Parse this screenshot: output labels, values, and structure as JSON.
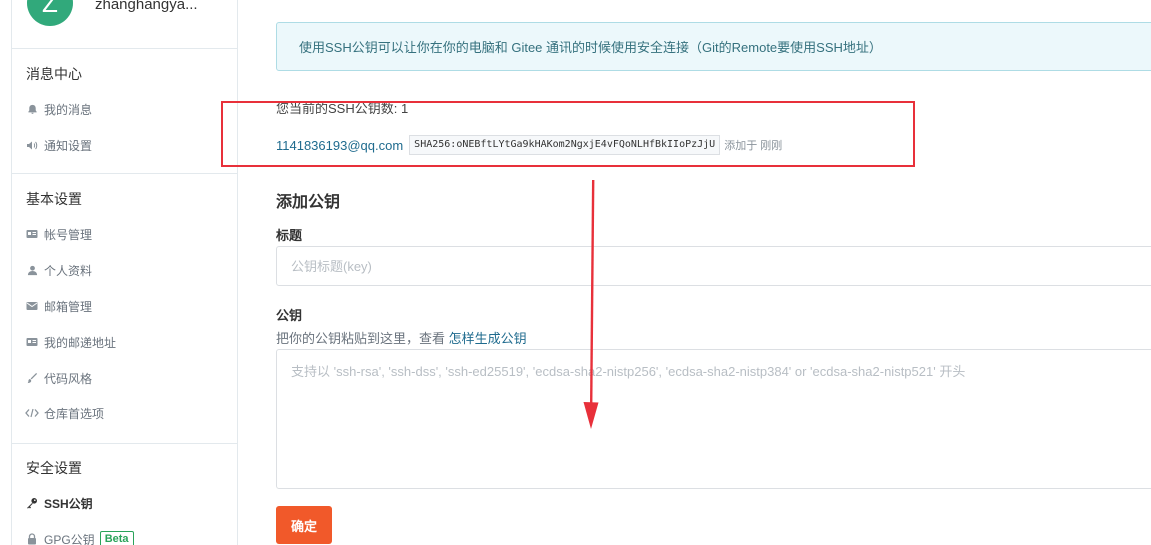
{
  "profile": {
    "avatar_letter": "Z",
    "username": "zhanghangya..."
  },
  "sidebar": {
    "messages": {
      "title": "消息中心",
      "items": [
        {
          "label": "我的消息",
          "icon": "bell-icon"
        },
        {
          "label": "通知设置",
          "icon": "volume-icon"
        }
      ]
    },
    "basic": {
      "title": "基本设置",
      "items": [
        {
          "label": "帐号管理",
          "icon": "id-card-icon"
        },
        {
          "label": "个人资料",
          "icon": "user-icon"
        },
        {
          "label": "邮箱管理",
          "icon": "mail-icon"
        },
        {
          "label": "我的邮递地址",
          "icon": "id-card-icon"
        },
        {
          "label": "代码风格",
          "icon": "brush-icon"
        },
        {
          "label": "仓库首选项",
          "icon": "code-icon"
        }
      ]
    },
    "security": {
      "title": "安全设置",
      "items": [
        {
          "label": "SSH公钥",
          "icon": "key-icon",
          "active": true
        },
        {
          "label": "GPG公钥",
          "icon": "lock-icon",
          "badge": "Beta"
        }
      ]
    }
  },
  "main": {
    "notice": "使用SSH公钥可以让你在你的电脑和 Gitee 通讯的时候使用安全连接（Git的Remote要使用SSH地址）",
    "key_count_text": "您当前的SSH公钥数: 1",
    "key": {
      "email": "1141836193@qq.com",
      "fingerprint": "SHA256:oNEBftLYtGa9kHAKom2NgxjE4vFQoNLHfBkIIoPzJjU",
      "added": "添加于 刚刚"
    },
    "add_heading": "添加公钥",
    "title_label": "标题",
    "title_placeholder": "公钥标题(key)",
    "key_label": "公钥",
    "key_hint": "把你的公钥粘贴到这里，查看",
    "key_hint_link": "怎样生成公钥",
    "key_placeholder": "支持以 'ssh-rsa', 'ssh-dss', 'ssh-ed25519', 'ecdsa-sha2-nistp256', 'ecdsa-sha2-nistp384' or 'ecdsa-sha2-nistp521' 开头",
    "submit_label": "确定"
  },
  "colors": {
    "accent": "#f1592a",
    "highlight": "#e8303a",
    "link": "#1f6b8e",
    "avatar": "#31a97b"
  }
}
